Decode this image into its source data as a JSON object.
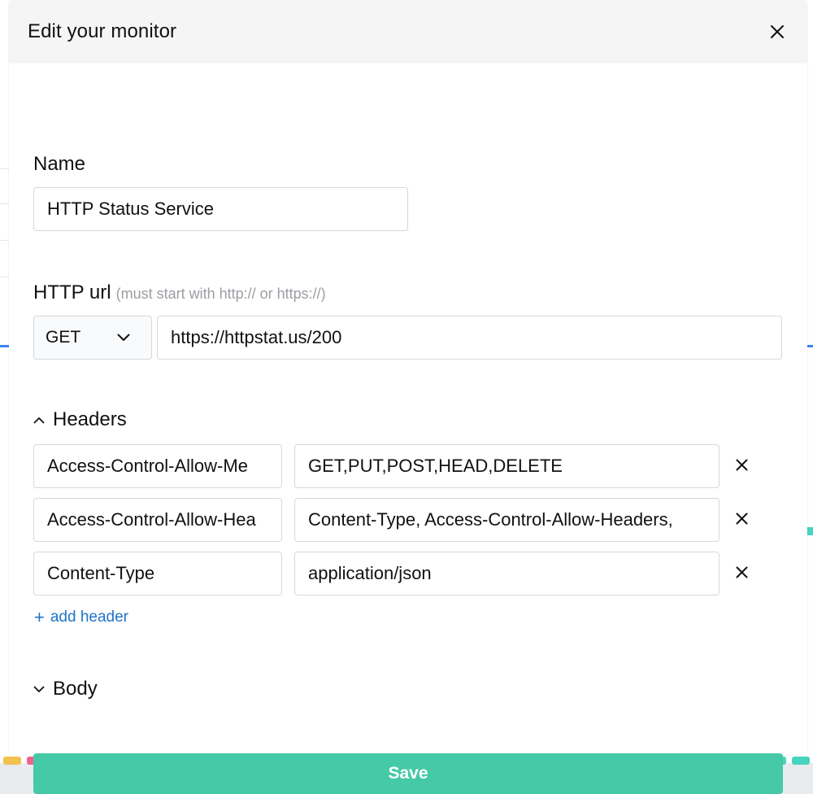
{
  "modal": {
    "title": "Edit your monitor"
  },
  "name_field": {
    "label": "Name",
    "value": "HTTP Status Service"
  },
  "url_field": {
    "label": "HTTP url",
    "hint": "(must start with http:// or https://)",
    "method": "GET",
    "value": "https://httpstat.us/200"
  },
  "headers_section": {
    "label": "Headers",
    "expanded": true,
    "rows": [
      {
        "key": "Access-Control-Allow-Me",
        "value": "GET,PUT,POST,HEAD,DELETE"
      },
      {
        "key": "Access-Control-Allow-Hea",
        "value": "Content-Type, Access-Control-Allow-Headers,"
      },
      {
        "key": "Content-Type",
        "value": "application/json"
      }
    ],
    "add_label": "add header"
  },
  "body_section": {
    "label": "Body",
    "expanded": false
  },
  "save_label": "Save",
  "colors": {
    "save_button": "#45c9a7",
    "link": "#1f72c8",
    "status_up": "#45d4c0",
    "status_down": "#f0648c",
    "status_degraded": "#f2c14e"
  },
  "icons": {
    "close": "close-icon",
    "method_dropdown": "chevron-down-icon",
    "headers_toggle": "chevron-up-icon",
    "body_toggle": "chevron-down-icon",
    "remove_header": "close-icon"
  }
}
